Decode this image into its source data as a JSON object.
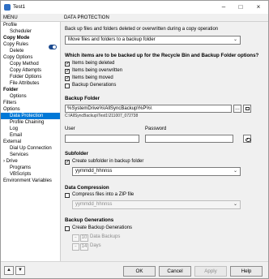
{
  "window": {
    "title": "Test1"
  },
  "left_header": "MENU",
  "right_header": "DATA PROTECTION",
  "tree": [
    {
      "label": "Profile",
      "indent": 0,
      "bold": false
    },
    {
      "label": "Scheduler",
      "indent": 1,
      "bold": false
    },
    {
      "label": "Copy Mode",
      "indent": 0,
      "bold": true
    },
    {
      "label": "Copy Rules",
      "indent": 0,
      "bold": false
    },
    {
      "label": "Delete",
      "indent": 1,
      "bold": false
    },
    {
      "label": "Copy Options",
      "indent": 0,
      "bold": false
    },
    {
      "label": "Copy Method",
      "indent": 1,
      "bold": false
    },
    {
      "label": "Copy Attempts",
      "indent": 1,
      "bold": false
    },
    {
      "label": "Folder Options",
      "indent": 1,
      "bold": false
    },
    {
      "label": "File Attributes",
      "indent": 1,
      "bold": false
    },
    {
      "label": "Folder",
      "indent": 0,
      "bold": true
    },
    {
      "label": "Options",
      "indent": 1,
      "bold": false
    },
    {
      "label": "Filters",
      "indent": 0,
      "bold": false
    },
    {
      "label": "Options",
      "indent": 0,
      "bold": false
    },
    {
      "label": "Data Protection",
      "indent": 1,
      "bold": false,
      "selected": true
    },
    {
      "label": "Profile Chaining",
      "indent": 1,
      "bold": false
    },
    {
      "label": "Log",
      "indent": 1,
      "bold": false
    },
    {
      "label": "Email",
      "indent": 1,
      "bold": false
    },
    {
      "label": "External",
      "indent": 0,
      "bold": false
    },
    {
      "label": "Dial Up Connection",
      "indent": 1,
      "bold": false
    },
    {
      "label": "Services",
      "indent": 1,
      "bold": false
    },
    {
      "label": "› Drive",
      "indent": 0,
      "bold": false
    },
    {
      "label": "Programs",
      "indent": 1,
      "bold": false
    },
    {
      "label": "VBScripts",
      "indent": 1,
      "bold": false
    },
    {
      "label": "Environment Variables",
      "indent": 0,
      "bold": false
    }
  ],
  "intro": {
    "text": "Back up files and folders deleted or overwritten during a copy operation",
    "mode_value": "Move files and folders to a backup folder"
  },
  "backup_items": {
    "title": "Which items are to be backed up for the Recycle Bin and Backup Folder options?",
    "options": [
      {
        "label": "Items being deleted",
        "checked": true
      },
      {
        "label": "Items being overwritten",
        "checked": true
      },
      {
        "label": "Items being moved",
        "checked": true
      },
      {
        "label": "Backup Generations",
        "checked": false
      }
    ]
  },
  "backup_folder": {
    "title": "Backup Folder",
    "path_value": "%SystemDrive%\\AllSyncBackup\\%P%\\",
    "resolved_path": "C:\\AllSyncBackup\\Test1\\211007_072738",
    "user_label": "User",
    "password_label": "Password",
    "user_value": "",
    "password_value": ""
  },
  "subfolder": {
    "title": "Subfolder",
    "create_label": "Create subfolder in backup folder",
    "create_checked": true,
    "format_value": "yymmdd_hhnnss"
  },
  "compression": {
    "title": "Data Compression",
    "label": "Compress files into a ZIP file",
    "checked": false,
    "format_value": "yymmdd_hhnnss"
  },
  "generations": {
    "title": "Backup Generations",
    "label": "Create Backup Generations",
    "checked": false,
    "data_backups_value": "10",
    "data_backups_label": "Data Backups",
    "days_value": "14",
    "days_label": "Days"
  },
  "buttons": {
    "ok": "OK",
    "cancel": "Cancel",
    "apply": "Apply",
    "help": "Help"
  }
}
